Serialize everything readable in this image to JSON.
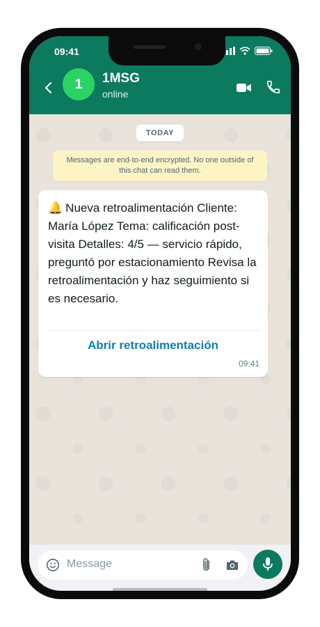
{
  "status_bar": {
    "time": "09:41"
  },
  "header": {
    "avatar_initial": "1",
    "contact_name": "1MSG",
    "contact_status": "online",
    "icons": [
      "back-arrow-icon",
      "video-call-icon",
      "phone-icon"
    ]
  },
  "chat": {
    "date_label": "TODAY",
    "encryption_notice": "Messages are end-to-end encrypted. No one outside of this chat can read them.",
    "message": {
      "emoji": "🔔",
      "text": "Nueva retroalimentación Cliente: María López Tema: calificación post-visita Detalles: 4/5 — servicio rápido, preguntó por estacionamiento Revisa la retroalimentación y haz seguimiento si es necesario.",
      "cta_label": "Abrir retroalimentación",
      "time": "09:41"
    }
  },
  "composer": {
    "placeholder": "Message",
    "icons": [
      "emoji-icon",
      "paperclip-icon",
      "camera-icon",
      "microphone-icon"
    ]
  },
  "colors": {
    "header_bg": "#0b7a5f",
    "avatar_bg": "#2bd365",
    "link": "#0d7fb0",
    "notice_bg": "#fcf4c5"
  }
}
